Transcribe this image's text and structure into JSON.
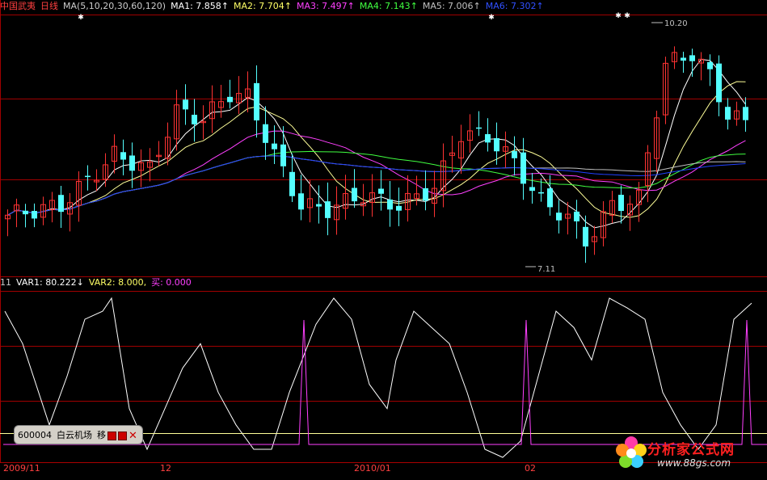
{
  "main_legend": {
    "stock_name": "中国武夷",
    "period": "日线",
    "ma_param": "MA(5,10,20,30,60,120)",
    "ma1": "MA1: 7.858↑",
    "ma2": "MA2: 7.704↑",
    "ma3": "MA3: 7.497↑",
    "ma4": "MA4: 7.143↑",
    "ma5": "MA5: 7.006↑",
    "ma6": "MA6: 7.302↑"
  },
  "price_labels": {
    "high": "10.20",
    "low": "7.11"
  },
  "sub_legend": {
    "prefix": "11",
    "var1": "VAR1: 80.222↓",
    "var2": "VAR2: 8.000,",
    "buy": "买: 0.000"
  },
  "popup": {
    "code": "600004",
    "name": "白云机场",
    "action": "移"
  },
  "time_axis": [
    "2009/11",
    "12",
    "2010/01",
    "02"
  ],
  "watermark": {
    "name": "分析家公式网",
    "url": "www.88gs.com"
  },
  "colors": {
    "up": "#ff3333",
    "down": "#54ffff",
    "ma1": "#ffffff",
    "ma2": "#ffff99",
    "ma3": "#ff40ff",
    "ma4": "#40ff40",
    "ma5": "#c0c0c0",
    "ma6": "#2040ff",
    "var1": "#ffffff",
    "buy": "#ff40ff",
    "grid": "#a00000"
  }
}
